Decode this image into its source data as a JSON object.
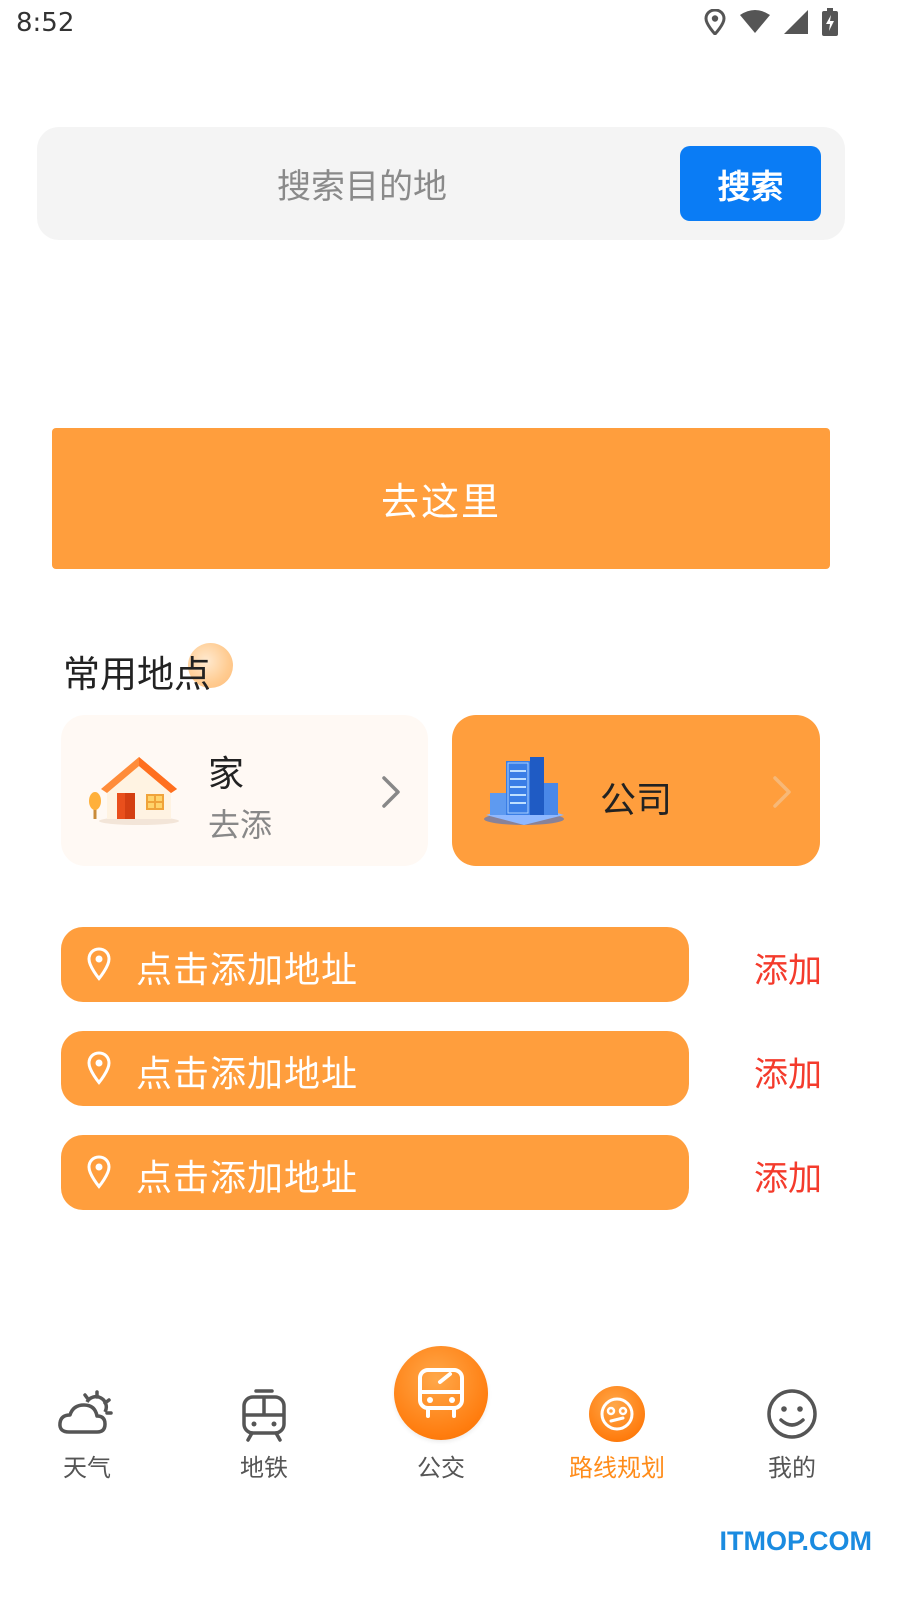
{
  "status_bar": {
    "time": "8:52"
  },
  "search": {
    "placeholder": "搜索目的地",
    "button_label": "搜索"
  },
  "go_button": {
    "label": "去这里"
  },
  "frequent_places": {
    "title": "常用地点",
    "home": {
      "title": "家",
      "subtitle": "去添"
    },
    "company": {
      "title": "公司"
    }
  },
  "address_rows": [
    {
      "label": "点击添加地址",
      "action": "添加"
    },
    {
      "label": "点击添加地址",
      "action": "添加"
    },
    {
      "label": "点击添加地址",
      "action": "添加"
    }
  ],
  "bottom_nav": [
    {
      "label": "天气",
      "icon": "weather-icon"
    },
    {
      "label": "地铁",
      "icon": "metro-icon"
    },
    {
      "label": "公交",
      "icon": "bus-icon"
    },
    {
      "label": "路线规划",
      "icon": "route-icon",
      "active": true
    },
    {
      "label": "我的",
      "icon": "smile-icon"
    }
  ],
  "watermark": "ITMOP.COM",
  "colors": {
    "accent_orange": "#ff9e3d",
    "search_blue": "#0a7cf5",
    "add_red": "#f43b2c",
    "active_nav": "#ff8c1a"
  }
}
